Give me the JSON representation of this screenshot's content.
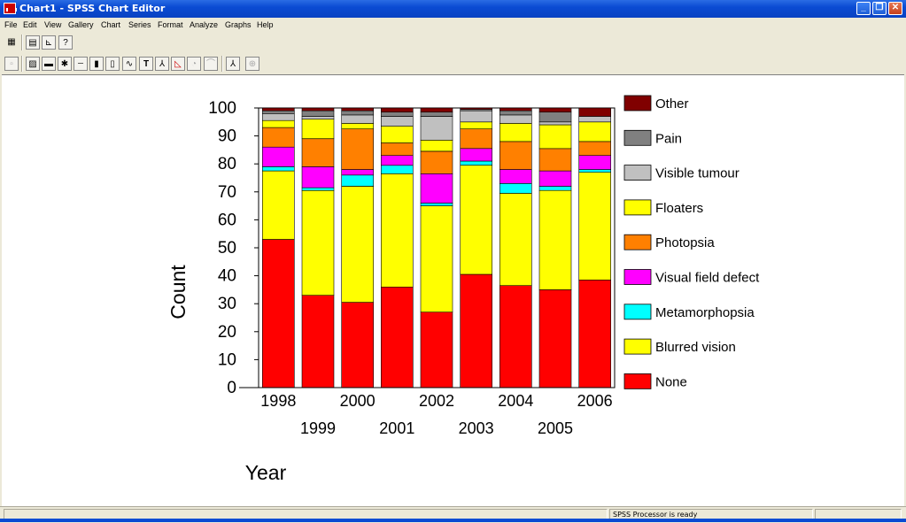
{
  "window": {
    "title": "Chart1 - SPSS Chart Editor",
    "minimize_label": "_",
    "maximize_label": "❐",
    "close_label": "✕"
  },
  "menu": [
    "File",
    "Edit",
    "View",
    "Gallery",
    "Chart",
    "Series",
    "Format",
    "Analyze",
    "Graphs",
    "Help"
  ],
  "toolbar1": [
    {
      "icon": "chart-select-icon",
      "glyph": "▦"
    },
    {
      "icon": "gallery-icon",
      "glyph": "▤"
    },
    {
      "icon": "chart-axis-icon",
      "glyph": "⊾"
    },
    {
      "icon": "help-cursor-icon",
      "glyph": "?"
    }
  ],
  "toolbar2": [
    {
      "icon": "select-icon",
      "glyph": "▫",
      "enabled": false
    },
    {
      "icon": "fill-pattern-icon",
      "glyph": "▨",
      "enabled": true
    },
    {
      "icon": "color-icon",
      "glyph": "▬",
      "enabled": true
    },
    {
      "icon": "marker-icon",
      "glyph": "✱",
      "enabled": true
    },
    {
      "icon": "line-style-icon",
      "glyph": "┄",
      "enabled": true
    },
    {
      "icon": "bar-style-icon",
      "glyph": "▮",
      "enabled": true
    },
    {
      "icon": "bar-label-icon",
      "glyph": "▯",
      "enabled": true
    },
    {
      "icon": "interpolation-icon",
      "glyph": "∿",
      "enabled": true
    },
    {
      "icon": "text-icon",
      "glyph": "T",
      "enabled": true
    },
    {
      "icon": "3d-rotation-icon",
      "glyph": "⅄",
      "enabled": true
    },
    {
      "icon": "swap-axes-icon",
      "glyph": "◺",
      "enabled": true
    },
    {
      "icon": "explode-slice-icon",
      "glyph": "◔",
      "enabled": false
    },
    {
      "icon": "break-line-icon",
      "glyph": "⌒",
      "enabled": false
    },
    {
      "icon": "spin-icon",
      "glyph": "⅄",
      "enabled": true
    },
    {
      "icon": "point-id-icon",
      "glyph": "⊕",
      "enabled": false
    }
  ],
  "status": {
    "processor": "SPSS Processor  is ready"
  },
  "colors": {
    "None": "#ff0000",
    "Blurred vision": "#ffff00",
    "Metamorphopsia": "#00ffff",
    "Visual field defect": "#ff00ff",
    "Photopsia": "#ff8000",
    "Floaters": "#ffff00",
    "Visible tumour": "#c0c0c0",
    "Pain": "#808080",
    "Other": "#800000"
  },
  "chart_data": {
    "type": "bar",
    "stacked": true,
    "categories": [
      "1998",
      "1999",
      "2000",
      "2001",
      "2002",
      "2003",
      "2004",
      "2005",
      "2006"
    ],
    "xlabel": "Year",
    "ylabel": "Count",
    "ylim": [
      0,
      100
    ],
    "yticks": [
      0,
      10,
      20,
      30,
      40,
      50,
      60,
      70,
      80,
      90,
      100
    ],
    "grid": false,
    "legend_position": "right",
    "series": [
      {
        "name": "None",
        "values": [
          53,
          33,
          30.5,
          36,
          27,
          40.5,
          36.5,
          35,
          38.5
        ]
      },
      {
        "name": "Blurred vision",
        "values": [
          24.5,
          37.5,
          41.5,
          40.5,
          38,
          39,
          33,
          35.5,
          38.5
        ]
      },
      {
        "name": "Metamorphopsia",
        "values": [
          1.5,
          1,
          4,
          3,
          1,
          1.5,
          3.5,
          1.5,
          1
        ]
      },
      {
        "name": "Visual field defect",
        "values": [
          7,
          7.5,
          2,
          3.5,
          10.5,
          4.5,
          5,
          5.5,
          5
        ]
      },
      {
        "name": "Photopsia",
        "values": [
          7,
          10,
          14.5,
          4.5,
          8,
          7,
          10,
          8,
          5
        ]
      },
      {
        "name": "Floaters",
        "values": [
          2.5,
          7,
          2,
          6,
          4,
          2.5,
          6.5,
          8.5,
          7
        ]
      },
      {
        "name": "Visible tumour",
        "values": [
          2.5,
          1,
          3,
          3.5,
          8.5,
          4,
          3,
          1,
          2
        ]
      },
      {
        "name": "Pain",
        "values": [
          1,
          2,
          1.5,
          1.5,
          1.5,
          0.5,
          1.5,
          3.5,
          0
        ]
      },
      {
        "name": "Other",
        "values": [
          1,
          1,
          1,
          1.5,
          1.5,
          0.5,
          1,
          1.5,
          3
        ]
      }
    ]
  }
}
